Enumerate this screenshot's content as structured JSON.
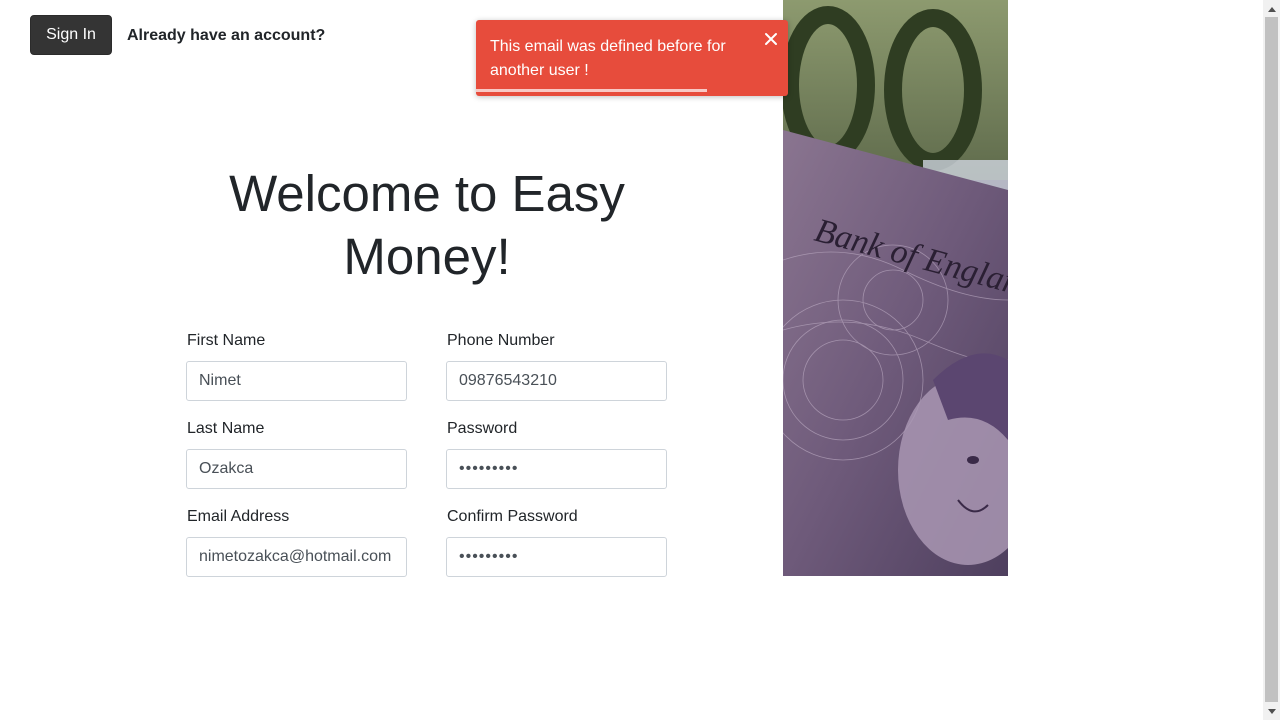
{
  "header": {
    "signin_label": "Sign In",
    "account_prompt": "Already have an account?"
  },
  "main": {
    "title": "Welcome to Easy Money!"
  },
  "form": {
    "first_name": {
      "label": "First Name",
      "value": "Nimet"
    },
    "phone": {
      "label": "Phone Number",
      "value": "09876543210"
    },
    "last_name": {
      "label": "Last Name",
      "value": "Ozakca"
    },
    "password": {
      "label": "Password",
      "value": "•••••••••"
    },
    "email": {
      "label": "Email Address",
      "value": "nimetozakca@hotmail.com"
    },
    "confirm_password": {
      "label": "Confirm Password",
      "value": "•••••••••"
    }
  },
  "toast": {
    "message": "This email was defined before for another user !",
    "type": "error",
    "color": "#e74c3c",
    "close_icon": "close-icon",
    "progress": 0.74
  },
  "colors": {
    "button_dark": "#343434",
    "text": "#212529",
    "error": "#e74c3c"
  }
}
